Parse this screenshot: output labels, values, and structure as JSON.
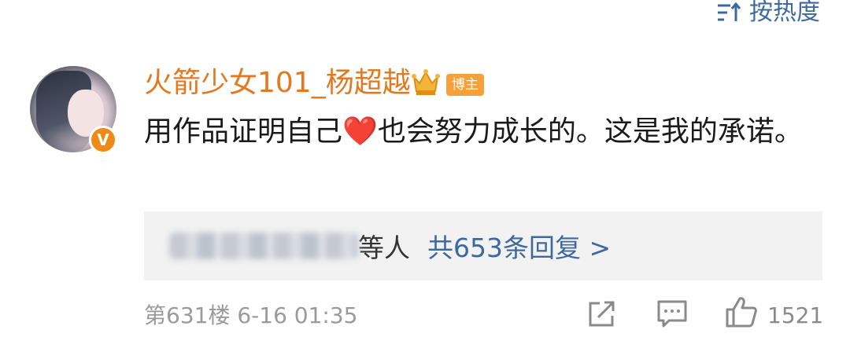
{
  "sort": {
    "label": "按热度",
    "icon": "sort-icon"
  },
  "comment": {
    "avatar_badge": "V",
    "username": "火箭少女101_杨超越",
    "host_badge": "博主",
    "text_before": "用作品证明自己",
    "emoji": "❤️",
    "text_after": "也会努力成长的。这是我的承诺。"
  },
  "replies": {
    "suffix": "等人",
    "total_label": "共653条回复 >"
  },
  "footer": {
    "floor": "第631楼",
    "date": "6-16 01:35",
    "like_count": "1521"
  },
  "colors": {
    "username": "#e3791e",
    "link": "#3c6aa0",
    "badge": "#f6a03a",
    "meta": "#9a9a9a"
  }
}
